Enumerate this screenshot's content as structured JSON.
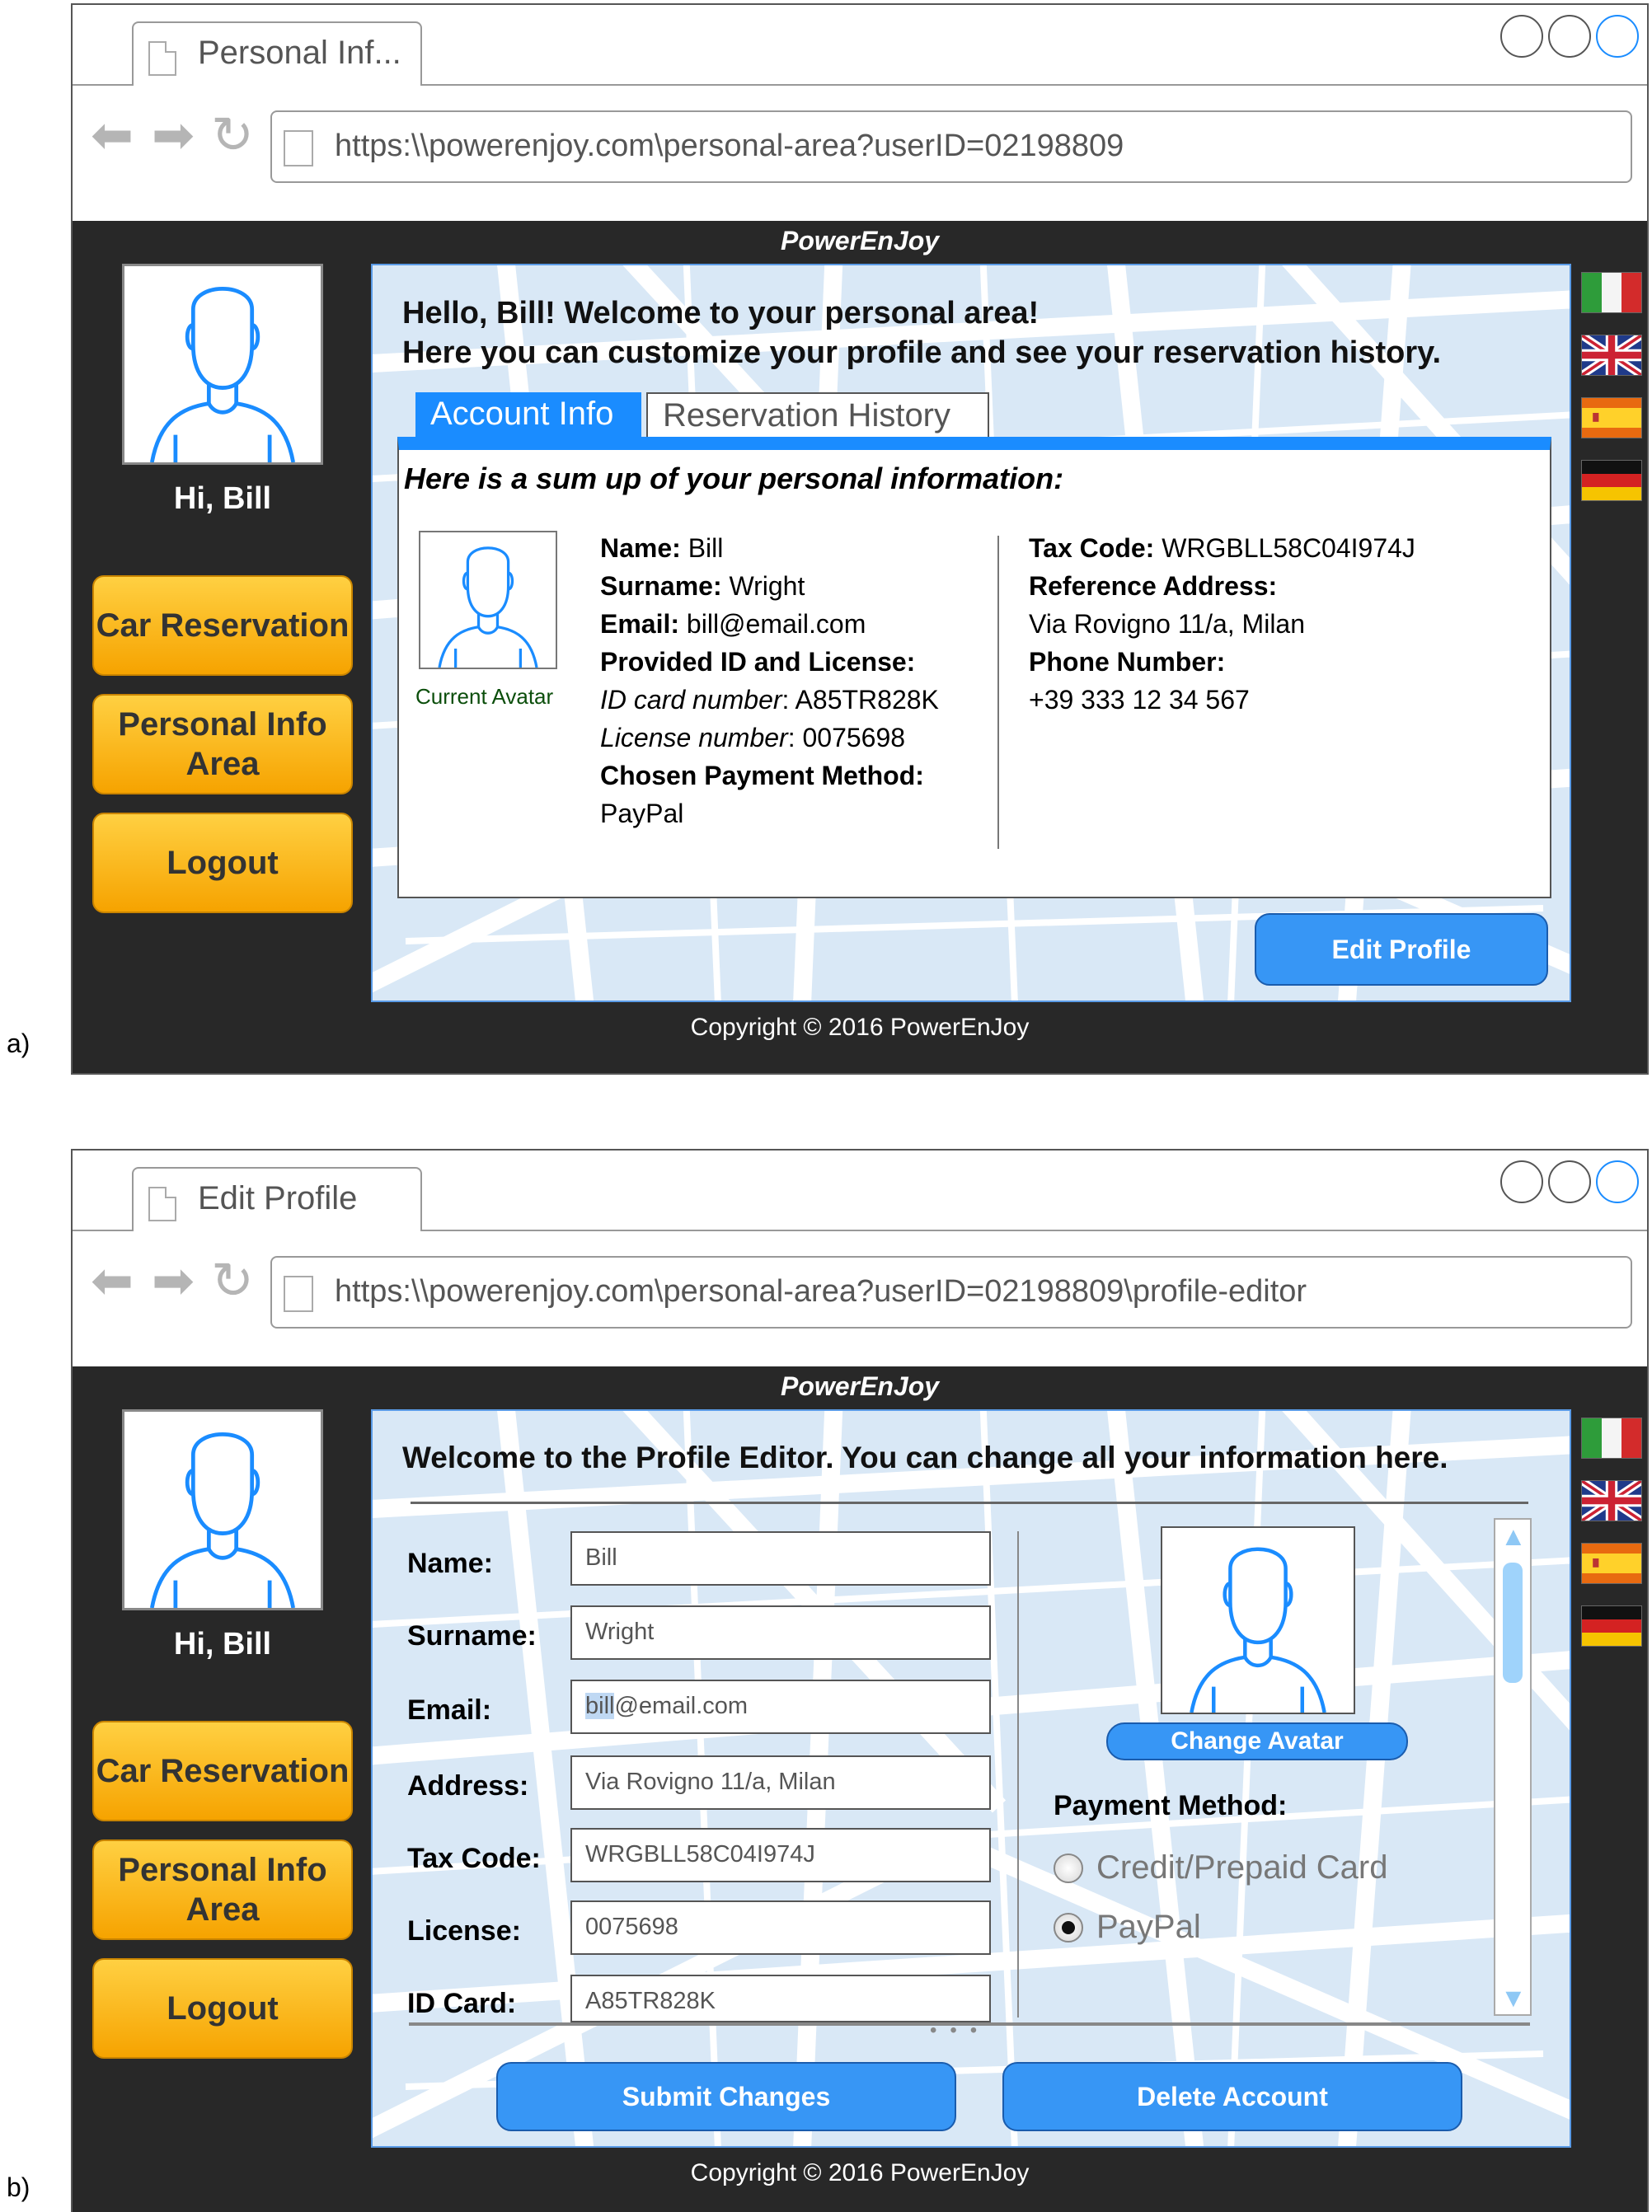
{
  "panel_a": {
    "label": "a)",
    "tab_title": "Personal Inf...",
    "url": "https:\\\\powerenjoy.com\\personal-area?userID=02198809",
    "brand": "PowerEnJoy",
    "greeting": "Hi, Bill",
    "sidebar": {
      "car_reservation": "Car Reservation",
      "personal_info": "Personal Info Area",
      "logout": "Logout"
    },
    "welcome_line1": "Hello, Bill! Welcome to your personal area!",
    "welcome_line2": "Here you can customize your profile and see your reservation history.",
    "tabs": [
      "Account Info",
      "Reservation History"
    ],
    "summary_title": "Here is a sum up of your personal information:",
    "current_avatar_label": "Current Avatar",
    "info": {
      "name_label": "Name:",
      "name": "Bill",
      "surname_label": "Surname:",
      "surname": "Wright",
      "email_label": "Email:",
      "email": "bill@email.com",
      "id_label": "Provided ID and License:",
      "id_card_label": "ID card number",
      "id_card": ": A85TR828K",
      "license_label": "License number",
      "license": ": 0075698",
      "payment_label": "Chosen Payment Method:",
      "payment": "PayPal",
      "tax_label": "Tax Code:",
      "tax": "WRGBLL58C04I974J",
      "address_label": "Reference Address:",
      "address": "Via Rovigno 11/a, Milan",
      "phone_label": "Phone Number:",
      "phone": "+39 333 12 34 567"
    },
    "edit_button": "Edit Profile",
    "copyright": "Copyright © 2016 PowerEnJoy"
  },
  "panel_b": {
    "label": "b)",
    "tab_title": "Edit Profile",
    "url": "https:\\\\powerenjoy.com\\personal-area?userID=02198809\\profile-editor",
    "brand": "PowerEnJoy",
    "greeting": "Hi, Bill",
    "sidebar": {
      "car_reservation": "Car Reservation",
      "personal_info": "Personal Info Area",
      "logout": "Logout"
    },
    "welcome": "Welcome to the Profile Editor. You can change all your information here.",
    "fields": {
      "name_label": "Name:",
      "name": "Bill",
      "surname_label": "Surname:",
      "surname": "Wright",
      "email_label": "Email:",
      "email_selected": "bill",
      "email_rest": "@email.com",
      "address_label": "Address:",
      "address": "Via Rovigno 11/a, Milan",
      "tax_label": "Tax Code:",
      "tax": "WRGBLL58C04I974J",
      "license_label": "License:",
      "license": "0075698",
      "id_label": "ID Card:",
      "id": "A85TR828K"
    },
    "change_avatar": "Change Avatar",
    "payment_label": "Payment Method:",
    "payment_options": [
      "Credit/Prepaid Card",
      "PayPal"
    ],
    "payment_selected": "PayPal",
    "submit_button": "Submit Changes",
    "delete_button": "Delete Account",
    "copyright": "Copyright © 2016 PowerEnJoy"
  },
  "icons": {
    "nav": [
      "back-arrow-icon",
      "forward-arrow-icon",
      "reload-icon"
    ],
    "flags": [
      "italy-flag-icon",
      "uk-flag-icon",
      "spain-flag-icon",
      "germany-flag-icon"
    ]
  },
  "colors": {
    "accent_blue": "#1a8cff",
    "button_orange": "#f6a300",
    "app_dark": "#282828"
  }
}
